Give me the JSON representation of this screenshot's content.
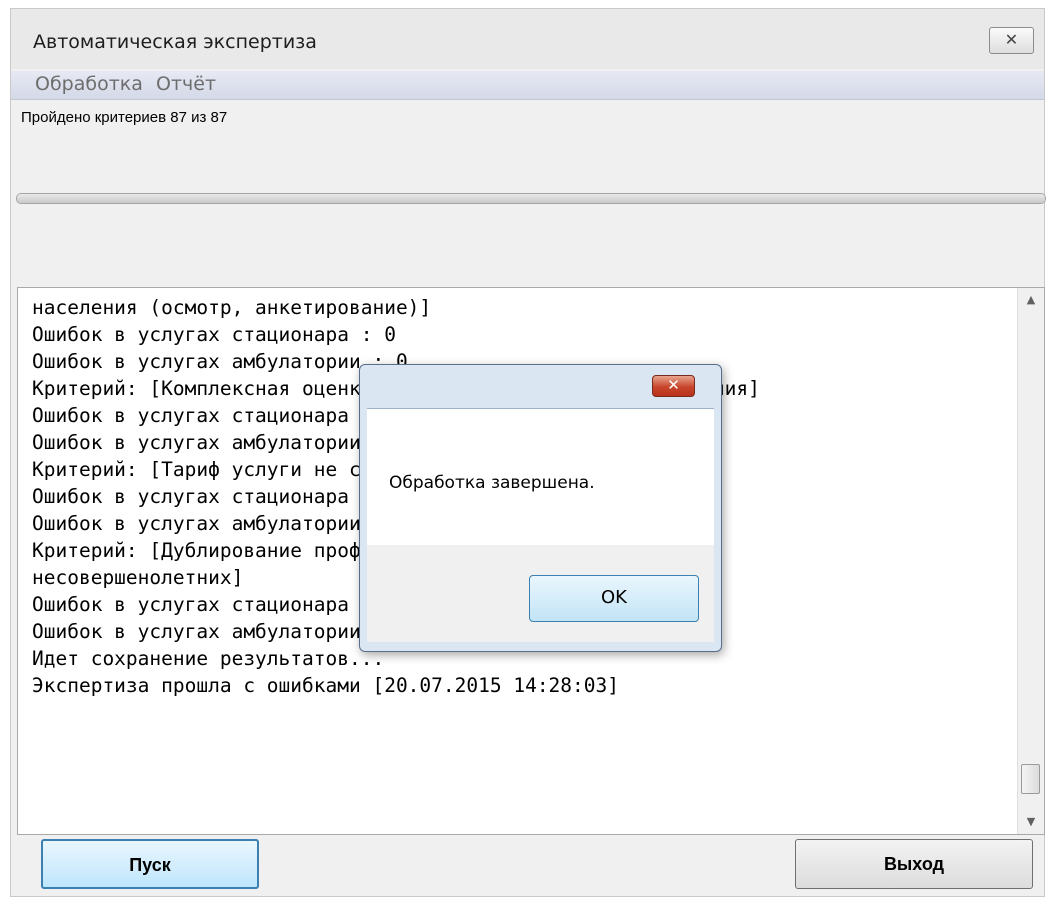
{
  "window": {
    "title": "Автоматическая экспертиза",
    "close_glyph": "✕"
  },
  "menu": [
    "Обработка",
    "Отчёт"
  ],
  "status": {
    "text": "Пройдено критериев 87 из 87",
    "progress_fraction": 1.0
  },
  "log": {
    "lines": [
      "населения (осмотр, анкетирование)]",
      "Ошибок в услугах стационара  : 0",
      "Ошибок в услугах амбулатории : 0",
      "Критерий: [Комплексная оценка диспансеризации и анкетирования]",
      "Ошибок в услугах стационара  : 0",
      "Ошибок в услугах амбулатории : 0",
      "Критерий: [Тариф услуги не соответствует прейскуранту]",
      "Ошибок в услугах стационара  : 0",
      "Ошибок в услугах амбулатории : 0",
      "Критерий: [Дублирование профилактических осмотров",
      "несовершенолетних]",
      "Ошибок в услугах стационара  : 0",
      "Ошибок в услугах амбулатории : 0",
      "Идет сохранение результатов...",
      "Экспертиза прошла с ошибками [20.07.2015 14:28:03]"
    ],
    "scroll_up_glyph": "▲",
    "scroll_down_glyph": "▼"
  },
  "buttons": {
    "start": "Пуск",
    "exit": "Выход"
  },
  "message_box": {
    "text": "Обработка завершена.",
    "ok": "OK",
    "close_glyph": "✕"
  }
}
